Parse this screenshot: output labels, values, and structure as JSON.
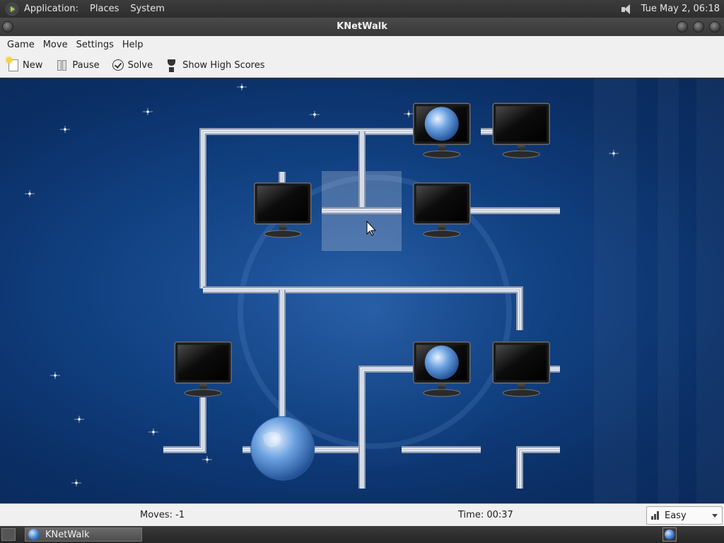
{
  "top_panel": {
    "menus": [
      "Application:",
      "Places",
      "System"
    ],
    "clock": "Tue May  2, 06:18"
  },
  "window": {
    "title": "KNetWalk"
  },
  "menubar": {
    "items": [
      "Game",
      "Move",
      "Settings",
      "Help"
    ]
  },
  "toolbar": {
    "new_label": "New",
    "pause_label": "Pause",
    "solve_label": "Solve",
    "highscores_label": "Show High Scores"
  },
  "statusbar": {
    "moves": "Moves: -1",
    "time": "Time: 00:37",
    "difficulty": "Easy"
  },
  "taskbar": {
    "task_label": "KNetWalk"
  },
  "board": {
    "grid_columns": 6,
    "grid_rows": 5,
    "note_cells": "row/col indices",
    "server_cell": [
      4,
      1
    ],
    "highlighted_cell": [
      1,
      2
    ],
    "computers": [
      {
        "row": 0,
        "col": 3,
        "connected": true
      },
      {
        "row": 0,
        "col": 4,
        "connected": false
      },
      {
        "row": 1,
        "col": 1,
        "connected": false
      },
      {
        "row": 1,
        "col": 3,
        "connected": false
      },
      {
        "row": 3,
        "col": 0,
        "connected": false
      },
      {
        "row": 3,
        "col": 3,
        "connected": true
      },
      {
        "row": 3,
        "col": 4,
        "connected": false
      }
    ]
  }
}
